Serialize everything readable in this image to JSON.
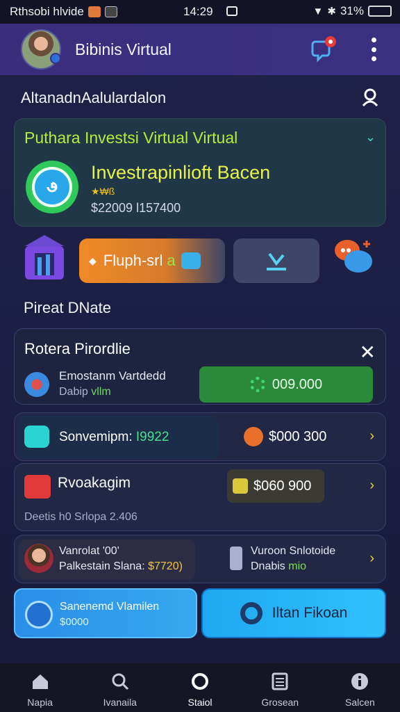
{
  "status_bar": {
    "carrier": "Rthsobi hlvide",
    "time": "14:29",
    "battery": "31%",
    "icons": [
      "app-icon",
      "app-icon",
      "message-icon",
      "wifi-icon",
      "bluetooth-icon",
      "battery-icon"
    ]
  },
  "header": {
    "title": "Bibinis Virtual",
    "icons": [
      "avatar",
      "chat-notification-icon",
      "more-vertical-icon"
    ]
  },
  "section1": {
    "title": "AltanadnAalulardalon",
    "icon": "user-icon"
  },
  "invest_card": {
    "heading": "Puthara Investsi Virtual Virtual",
    "name": "Investrapinlioft Bacen",
    "badge": "★₩ß",
    "amount": "$22009 l157400",
    "colors": {
      "heading": "#b8ec3a",
      "name": "#e8f34a"
    }
  },
  "actions": {
    "orange_label": "Fluph-srl",
    "orange_label_suffix": "a",
    "icons": [
      "building-icon",
      "chart-icon",
      "download-icon",
      "chat-bubbles-icon"
    ]
  },
  "section2": {
    "title": "Pireat DNate"
  },
  "rota_card": {
    "heading": "Rotera Pirordlie",
    "line1": "Emostanm Vartdedd",
    "line2": "Dabip",
    "line2_green": "vllm",
    "button_value": "009.000"
  },
  "row1": {
    "label": "Sonvemipm:",
    "label_green": "I9922",
    "price": "$000 300"
  },
  "row2": {
    "label": "Rvoakagim",
    "price": "$060 900",
    "sub": "Deetis h0 Srlopa 2.406"
  },
  "row3": {
    "l1": "Vanrolat '00'",
    "l2": "Palkestain Slana:",
    "l2_yellow": "$7720)",
    "r1": "Vuroon Snlotoide",
    "r2": "Dnabis",
    "r2_green": "mio"
  },
  "bottom": {
    "left_l1": "Sanenemd Vlamilen",
    "left_l2": "$0000",
    "right_label": "Iltan Fikoan"
  },
  "tabs": [
    {
      "label": "Napia",
      "icon": "home-icon"
    },
    {
      "label": "Ivanaila",
      "icon": "search-icon"
    },
    {
      "label": "Staiol",
      "icon": "circle-icon"
    },
    {
      "label": "Grosean",
      "icon": "calculator-icon"
    },
    {
      "label": "Salcen",
      "icon": "info-icon"
    }
  ]
}
